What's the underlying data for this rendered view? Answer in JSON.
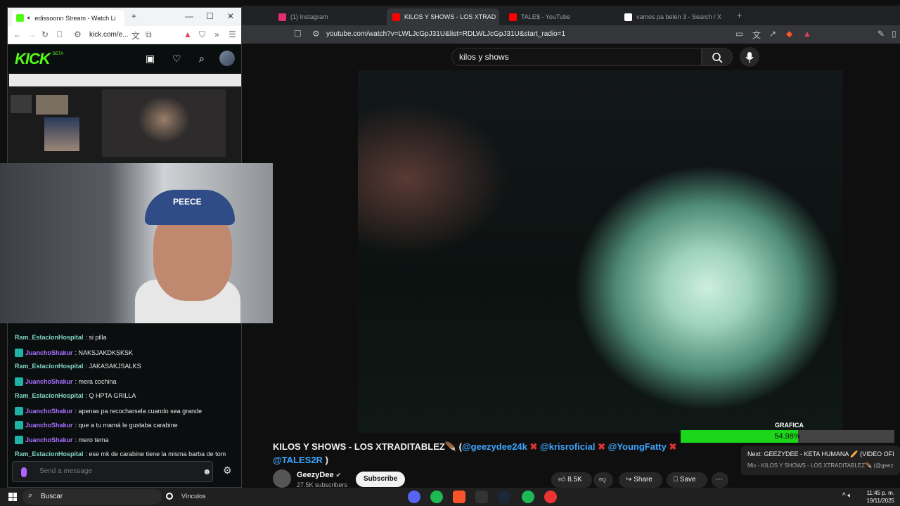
{
  "bg_browser": {
    "tabs": [
      {
        "label": "(1) Instagram",
        "icon": "instagram-icon",
        "color": "#e1306c"
      },
      {
        "label": "KILOS Y SHOWS - LOS XTRAD",
        "icon": "youtube-icon",
        "color": "#ff0000",
        "active": true
      },
      {
        "label": "TALE$ - YouTube",
        "icon": "youtube-icon",
        "color": "#ff0000"
      },
      {
        "label": "vamos pa belen 3 - Search / X",
        "icon": "x-icon",
        "color": "#ffffff"
      }
    ],
    "url": "youtube.com/watch?v=LWLJcGpJ31U&list=RDLWLJcGpJ31U&start_radio=1"
  },
  "youtube": {
    "search_value": "kilos y shows",
    "title_prefix": "KILOS Y SHOWS - LOS XTRADITABLEZ🪶 (",
    "mention1": "@geezydee24k",
    "mention2": "@krisroficial",
    "mention3": "@YoungFatty",
    "mention4": "@TALES2R",
    "title_suffix": " )",
    "xmark": "✖",
    "channel_name": "GeezyDee",
    "subscribers": "27.5K subscribers",
    "subscribe_label": "Subscribe",
    "likes": "8.5K",
    "share_label": "Share",
    "save_label": "Save"
  },
  "overlay": {
    "grafica_label": "GRAFICA",
    "grafica_value": "54.98%",
    "grafica_fraction": 0.5498
  },
  "next_card": {
    "title": "Next: GEEZYDEE - KETA HUMANA 🥖 (VIDEO OFICI...",
    "subtitle": "Mix - KILOS Y SHOWS - LOS XTRADITABLEZ🪶 (@geezydee..."
  },
  "fg_browser": {
    "tab_title": "edissoonn Stream - Watch Li",
    "url": "kick.com/e..."
  },
  "kick": {
    "logo": "KICK",
    "beta": "BETA"
  },
  "chat": [
    {
      "user": "Ram_EstacionHospital",
      "msg": ": si pilla",
      "kind": "ram"
    },
    {
      "user": "JuanchoShakur",
      "msg": ": NAKSJAKDKSKSK",
      "kind": "jc"
    },
    {
      "user": "Ram_EstacionHospital",
      "msg": ": JAKASAKJSALKS",
      "kind": "ram"
    },
    {
      "user": "JuanchoShakur",
      "msg": ": mera cochina",
      "kind": "jc"
    },
    {
      "user": "Ram_EstacionHospital",
      "msg": ": Q HPTA GRILLA",
      "kind": "ram"
    },
    {
      "user": "JuanchoShakur",
      "msg": ": apenas pa recocharsela cuando sea grande",
      "kind": "jc"
    },
    {
      "user": "JuanchoShakur",
      "msg": ": que a tu mamá le gustaba carabine",
      "kind": "jc"
    },
    {
      "user": "JuanchoShakur",
      "msg": ": mero tema",
      "kind": "jc"
    },
    {
      "user": "Ram_EstacionHospital",
      "msg": ": ese mk de carabine tiene la misma barba de tom",
      "kind": "ram"
    }
  ],
  "chat_input": {
    "placeholder": "Send a message"
  },
  "webcam": {
    "cap_text": "PEECE"
  },
  "taskbar": {
    "search_label": "Buscar",
    "vinculos": "Vínculos",
    "time": "11:45 p. m.",
    "date": "19/11/2025"
  }
}
